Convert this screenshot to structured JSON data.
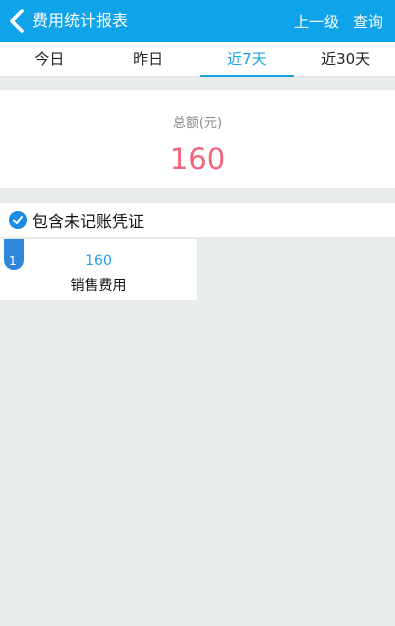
{
  "header": {
    "title": "费用统计报表",
    "up_level": "上一级",
    "query": "查询"
  },
  "tabs": [
    {
      "label": "今日"
    },
    {
      "label": "昨日"
    },
    {
      "label": "近7天",
      "active": true
    },
    {
      "label": "近30天"
    }
  ],
  "summary": {
    "label": "总额(元)",
    "value": "160"
  },
  "checkbox": {
    "label": "包含未记账凭证",
    "checked": true
  },
  "items": [
    {
      "index": "1",
      "amount": "160",
      "name": "销售费用"
    }
  ],
  "colors": {
    "header_bg": "#0fa3ea",
    "accent": "#1aa2e6",
    "total_value": "#f0667b",
    "badge": "#2f86db"
  }
}
